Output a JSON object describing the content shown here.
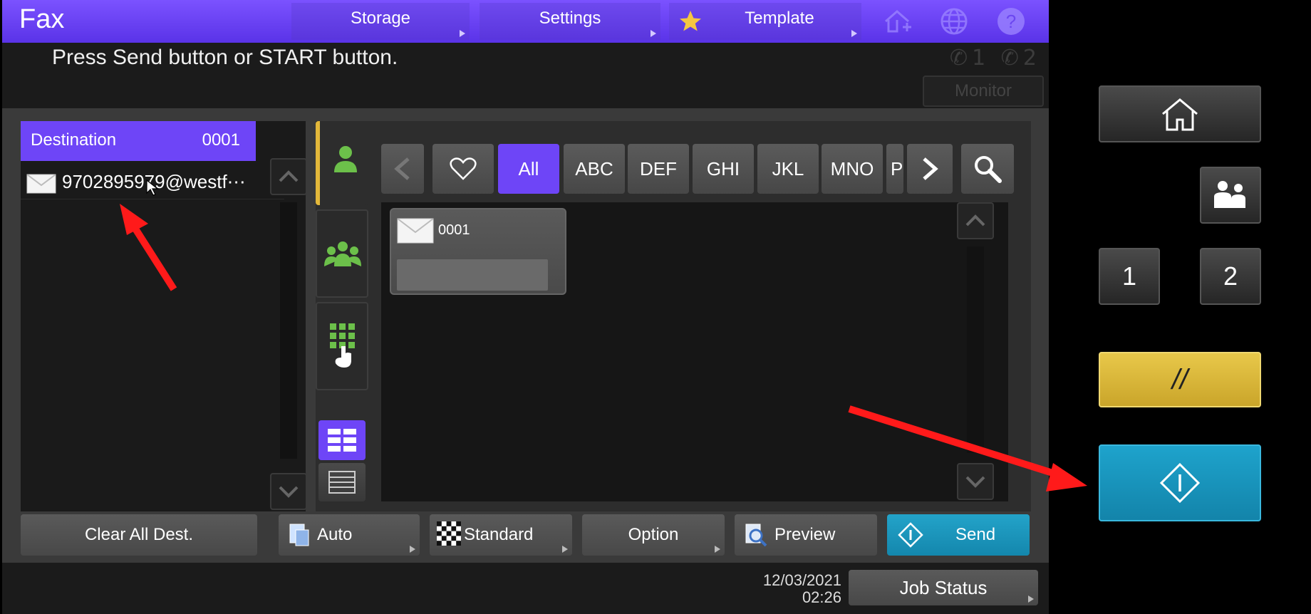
{
  "header": {
    "title": "Fax",
    "storage_label": "Storage",
    "settings_label": "Settings",
    "template_label": "Template"
  },
  "message": "Press Send button or START button.",
  "lines": {
    "line1": "1",
    "line2": "2"
  },
  "monitor_label": "Monitor",
  "destination": {
    "label": "Destination",
    "count": "0001",
    "entry": "9702895979@westf⋯"
  },
  "address_book": {
    "filters": [
      "All",
      "ABC",
      "DEF",
      "GHI",
      "JKL",
      "MNO",
      "P"
    ],
    "card_label": "0001"
  },
  "bottom": {
    "clear_label": "Clear All Dest.",
    "auto_label": "Auto",
    "standard_label": "Standard",
    "option_label": "Option",
    "preview_label": "Preview",
    "send_label": "Send"
  },
  "footer": {
    "date": "12/03/2021",
    "time": "02:26",
    "job_status_label": "Job Status"
  },
  "hardware": {
    "key1": "1",
    "key2": "2",
    "clear_symbol": "//"
  },
  "colors": {
    "accent": "#6e45f7",
    "send": "#1a96bd",
    "reset_key": "#e3c23a",
    "start_key": "#1590b8",
    "annotation": "#ff1a1a",
    "green_icon": "#6cc04a"
  }
}
